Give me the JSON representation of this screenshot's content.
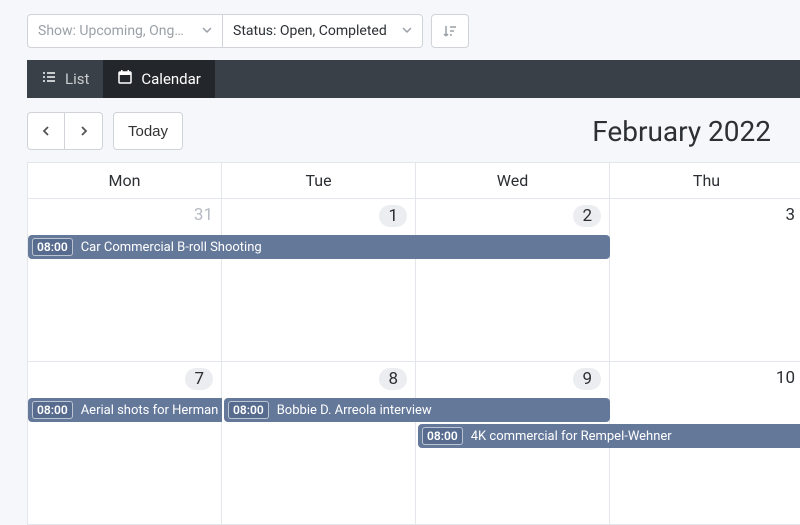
{
  "filters": {
    "show": {
      "label": "Show: Upcoming, Ong…"
    },
    "status": {
      "label": "Status: Open, Completed"
    }
  },
  "tabs": {
    "list": "List",
    "calendar": "Calendar"
  },
  "nav": {
    "today": "Today",
    "month_title": "February 2022"
  },
  "dow": [
    "Mon",
    "Tue",
    "Wed",
    "Thu"
  ],
  "weeks": [
    {
      "days": [
        "31",
        "1",
        "2",
        "3"
      ],
      "muted_first": true
    },
    {
      "days": [
        "7",
        "8",
        "9",
        "10"
      ],
      "muted_first": false
    }
  ],
  "events": {
    "w0": [
      {
        "time": "08:00",
        "title": "Car Commercial B-roll Shooting"
      }
    ],
    "w1": [
      {
        "time": "08:00",
        "title": "Aerial shots for Herman LL"
      },
      {
        "time": "08:00",
        "title": "Bobbie D. Arreola interview"
      },
      {
        "time": "08:00",
        "title": "4K commercial for Rempel-Wehner"
      }
    ]
  }
}
